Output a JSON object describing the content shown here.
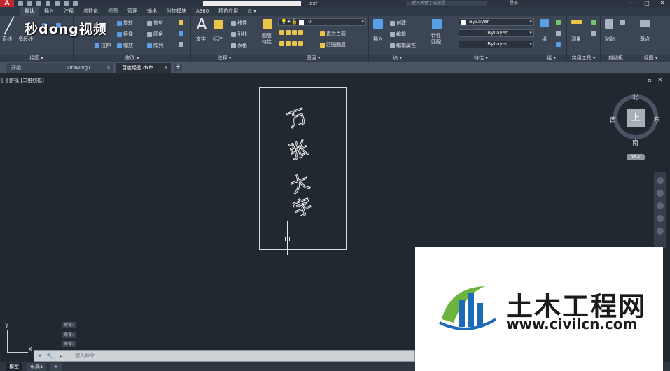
{
  "app": {
    "logo": "A",
    "doc_title": ".dxf",
    "search_placeholder": "键入关键字或短语",
    "login": "登录",
    "win_min": "─",
    "win_max": "□",
    "win_close": "✕"
  },
  "ribbon_tabs": [
    "默认",
    "插入",
    "注释",
    "参数化",
    "视图",
    "管理",
    "输出",
    "附加模块",
    "A360",
    "精选应用",
    "⊡ ▾"
  ],
  "ribbon": {
    "draw": {
      "label": "绘图 ▾",
      "line": "直线",
      "polyline": "多段线"
    },
    "modify": {
      "label": "修改 ▾",
      "rotate": "旋转",
      "trim": "修剪",
      "mirror": "镜像",
      "fillet": "圆角",
      "stretch": "拉伸",
      "scale": "缩放",
      "array": "阵列"
    },
    "annotation": {
      "label": "注释 ▾",
      "text": "文字",
      "dimension": "标注",
      "linear": "线性",
      "leader": "引线",
      "table": "表格"
    },
    "layers": {
      "label": "图层 ▾",
      "layer_props": "图层\n特性",
      "current_layer": "0",
      "make_current": "置为当前",
      "match_layer": "匹配图层"
    },
    "block": {
      "label": "块 ▾",
      "insert": "插入",
      "create": "创建",
      "edit": "编辑",
      "edit_attr": "编辑属性"
    },
    "properties": {
      "label": "特性 ▾",
      "match": "特性\n匹配",
      "color": "ByLayer",
      "linetype": "ByLayer",
      "lineweight": "ByLayer"
    },
    "groups": {
      "label": "组 ▾",
      "group": "组"
    },
    "utilities": {
      "label": "实用工具 ▾",
      "measure": "测量"
    },
    "clipboard": {
      "label": "剪贴板",
      "paste": "粘贴"
    },
    "view": {
      "label": "视图 ▾",
      "base": "基点"
    }
  },
  "watermark_top": "秒dong视频",
  "doc_tabs": [
    {
      "label": "开始"
    },
    {
      "label": "Drawing1"
    },
    {
      "label": "百度经验.dxf*"
    }
  ],
  "add_tab": "+",
  "viewport": {
    "label": "[-][俯视][二维线框]",
    "controls": "− ▫ ✕",
    "cad_chars": [
      "万",
      "张",
      "大",
      "字"
    ]
  },
  "viewcube": {
    "north": "北",
    "south": "南",
    "east": "东",
    "west": "西",
    "face": "上",
    "wcs": "WCS"
  },
  "ucs": {
    "x": "X",
    "y": "Y"
  },
  "command_history": [
    "命令:",
    "命令:",
    "命令:"
  ],
  "command_line": {
    "placeholder": "键入命令"
  },
  "layout_tabs": [
    "模型",
    "布局1",
    "+"
  ],
  "civil_watermark": {
    "name": "土木工程网",
    "url": "www.civilcn.com"
  },
  "colors": {
    "canvas": "#212830",
    "ribbon": "#3b4554",
    "accent": "#c4262e",
    "civil_blue": "#1d6bb8",
    "civil_green": "#6db33f"
  }
}
